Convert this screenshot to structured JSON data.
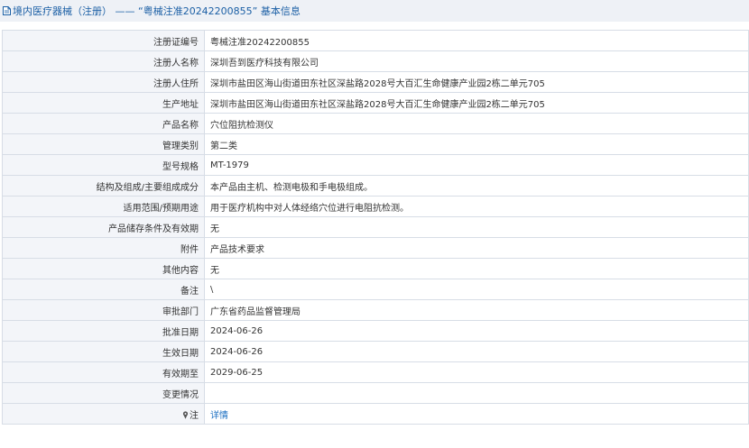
{
  "header": {
    "title": "境内医疗器械（注册） —— “粤械注准20242200855” 基本信息"
  },
  "rows": [
    {
      "label": "注册证编号",
      "value": "粤械注准20242200855"
    },
    {
      "label": "注册人名称",
      "value": "深圳吾到医疗科技有限公司"
    },
    {
      "label": "注册人住所",
      "value": "深圳市盐田区海山街道田东社区深盐路2028号大百汇生命健康产业园2栋二单元705"
    },
    {
      "label": "生产地址",
      "value": "深圳市盐田区海山街道田东社区深盐路2028号大百汇生命健康产业园2栋二单元705"
    },
    {
      "label": "产品名称",
      "value": "穴位阻抗检测仪"
    },
    {
      "label": "管理类别",
      "value": "第二类"
    },
    {
      "label": "型号规格",
      "value": "MT-1979"
    },
    {
      "label": "结构及组成/主要组成成分",
      "value": "本产品由主机、检测电极和手电极组成。"
    },
    {
      "label": "适用范围/预期用途",
      "value": "用于医疗机构中对人体经络穴位进行电阻抗检测。"
    },
    {
      "label": "产品储存条件及有效期",
      "value": "无"
    },
    {
      "label": "附件",
      "value": "产品技术要求"
    },
    {
      "label": "其他内容",
      "value": "无"
    },
    {
      "label": "备注",
      "value": "\\"
    },
    {
      "label": "审批部门",
      "value": "广东省药品监督管理局"
    },
    {
      "label": "批准日期",
      "value": "2024-06-26"
    },
    {
      "label": "生效日期",
      "value": "2024-06-26"
    },
    {
      "label": "有效期至",
      "value": "2029-06-25"
    },
    {
      "label": "变更情况",
      "value": ""
    }
  ],
  "note_row": {
    "label": "注",
    "link": "详情"
  },
  "colors": {
    "title": "#1b5fa5",
    "label_bg": "#f3f5f9",
    "border": "#d7dde6",
    "link": "#1b6fc2"
  },
  "icons": {
    "title_icon": "document-icon",
    "note_icon": "pin-icon"
  }
}
